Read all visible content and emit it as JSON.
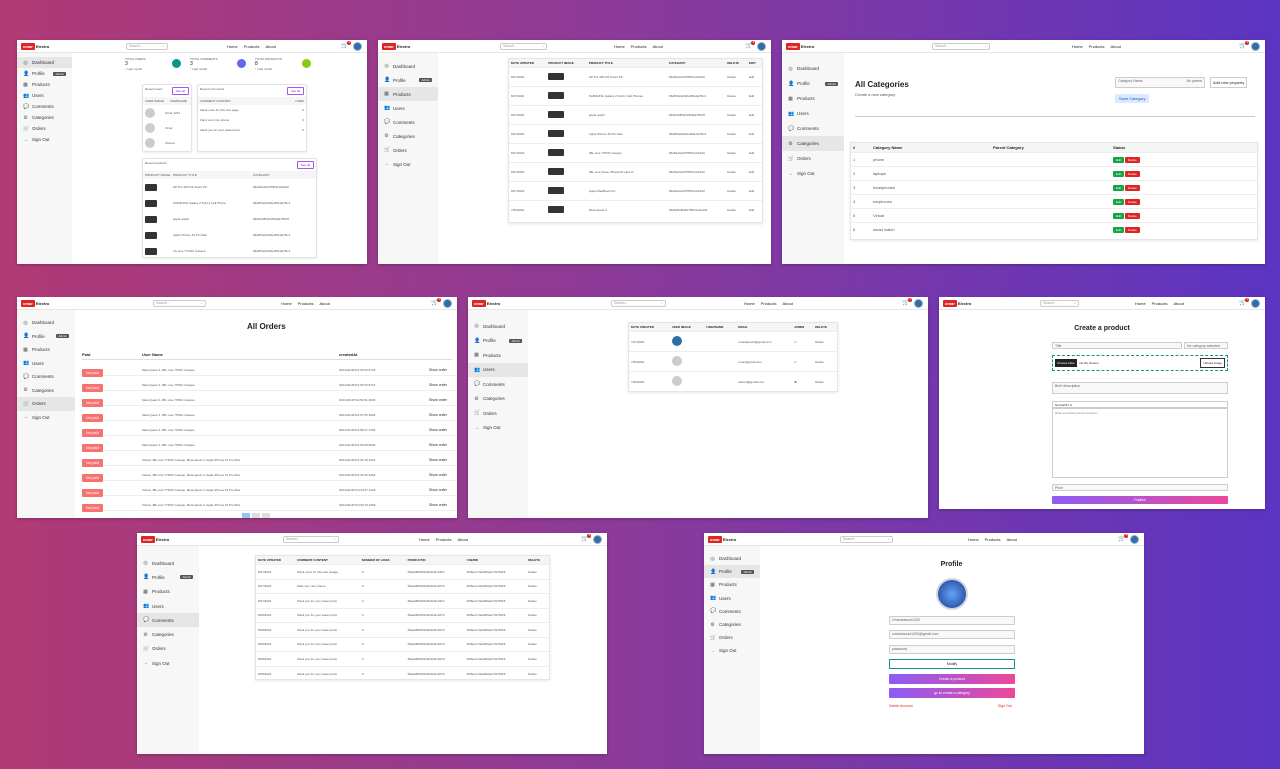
{
  "brand": {
    "first": "omar",
    "second": "Electro"
  },
  "nav": {
    "search": "Search...",
    "home": "Home",
    "products": "Products",
    "about": "About",
    "cart_count": "0"
  },
  "sidebar": {
    "dashboard": "Dashboard",
    "profile": "Profile",
    "admin_badge": "Admin",
    "products": "Products",
    "users": "Users",
    "comments": "Comments",
    "categories": "Categories",
    "orders": "Orders",
    "signout": "Sign Out"
  },
  "dashboard": {
    "stats": [
      {
        "label": "TOTAL USERS",
        "value": "3",
        "sub": "↑ Last month"
      },
      {
        "label": "TOTAL COMMENTS",
        "value": "3",
        "sub": "↑ Last month"
      },
      {
        "label": "TOTAL PRODUCTS",
        "value": "8",
        "sub": "↑ Last month"
      }
    ],
    "recent_users_title": "Recent users",
    "see_all": "See all",
    "user_cols": [
      "USER IMAGE",
      "USERNAME"
    ],
    "users": [
      "Omar 1231",
      "Omar",
      "Ahmed"
    ],
    "recent_comments_title": "Recent comments",
    "comment_cols": [
      "COMMENT CONTENT",
      "LIKES"
    ],
    "comments": [
      {
        "t": "thank omar for this nice page",
        "l": "0"
      },
      {
        "t": "that's very nice phone",
        "l": "0"
      },
      {
        "t": "thank you for your sweet price",
        "l": "0"
      }
    ],
    "recent_products_title": "Recent products",
    "product_cols": [
      "PRODUCT IMAGE",
      "PRODUCT TITLE",
      "CATEGORY"
    ],
    "products": [
      {
        "t": "HP Pro 400 G9 Tower PC",
        "c": "66a52a4c6d7f5637e6a440"
      },
      {
        "t": "SAMSUNG Galaxy Z Fold 4 Cell Phone",
        "c": "66a5b52a2f42e2f91da7fbc1"
      },
      {
        "t": "apple watch",
        "c": "66a5cf28f32c2f6da47530f7"
      },
      {
        "t": "Apple iPhone 15 Pro Max",
        "c": "66a5b52a2f42e2f91da7fbc1"
      },
      {
        "t": "LG Line 77OHC Casque",
        "c": "66a5b52a2f42e2f91da7fbc1"
      }
    ]
  },
  "products_page": {
    "cols": [
      "DATE UPDATED",
      "PRODUCT IMAGE",
      "PRODUCT TITLE",
      "CATEGORY",
      "DELETE",
      "EDIT"
    ],
    "rows": [
      {
        "d": "8/27/2024",
        "t": "HP Pro 400 G9 Tower PC",
        "c": "66a52a4c6d7f5637e6a440"
      },
      {
        "d": "8/27/2024",
        "t": "SAMSUNG Galaxy Z Fold 4 Cell Phones",
        "c": "66a5b52a2f42e2f91da7fbc1"
      },
      {
        "d": "8/27/2024",
        "t": "apple watch",
        "c": "66a5cf28f32c2f6da47530f7"
      },
      {
        "d": "8/27/2024",
        "t": "Apple iPhone 15 Pro Max",
        "c": "66a5b52a2f42e2f91da7fbc1"
      },
      {
        "d": "8/27/2024",
        "t": "JBL Line 770NC Casque",
        "c": "66a52a4c6d7f5637e6a440"
      },
      {
        "d": "8/27/2024",
        "t": "JBL Line Noise, Bluetooth sans fil",
        "c": "66a52a4c6d7f5637e6a440"
      },
      {
        "d": "8/27/2024",
        "t": "Apple MacBook Pro",
        "c": "66a52a4c6d7f5637e6a440"
      },
      {
        "d": "7/30/2024",
        "t": "Meta Quest 3",
        "c": "66a52f6d5d6d7f5637e6a440"
      }
    ],
    "delete": "Delete",
    "edit": "Edit"
  },
  "categories_page": {
    "title": "All Categories",
    "subtitle": "Create a new category",
    "name_ph": "Category Name",
    "parent_ph": "No parent",
    "add_prop": "Add new property",
    "save": "Save Category",
    "cols": [
      "#",
      "Category Name",
      "Parent Category",
      "Status"
    ],
    "rows": [
      {
        "n": "1",
        "c": "phone"
      },
      {
        "n": "2",
        "c": "laptops"
      },
      {
        "n": "3",
        "c": "headphones"
      },
      {
        "n": "4",
        "c": "earphones"
      },
      {
        "n": "5",
        "c": "Virtual"
      },
      {
        "n": "6",
        "c": "smart watch"
      }
    ],
    "edit": "Edit",
    "delete": "Delete"
  },
  "orders_page": {
    "title": "All Orders",
    "cols": [
      "Paid",
      "User Name",
      "createdAt"
    ],
    "not_paid": "Not paid",
    "show": "Show order",
    "rows": [
      {
        "u": "Meta Quest 3, JBL Line 770NC Casque",
        "d": "2024-08-30T11:52:53.072Z"
      },
      {
        "u": "Meta Quest 3, JBL Line 770NC Casque",
        "d": "2024-08-30T11:52:53.647Z"
      },
      {
        "u": "Meta Quest 3, JBL Line 770NC Casque",
        "d": "2024-08-30T11:54:51.400Z"
      },
      {
        "u": "Meta Quest 3, JBL Line 770NC Casque",
        "d": "2024-08-30T11:57:05.460Z"
      },
      {
        "u": "Meta Quest 3, JBL Line 770NC Casque",
        "d": "2024-08-30T11:58:47.770Z"
      },
      {
        "u": "Meta Quest 3, JBL Line 770NC Casque",
        "d": "2024-08-30T11:59:28.560Z"
      },
      {
        "u": "Virtual, JBL Line 770NC Casque, Meta Quest 3, Apple iPhone 15 Pro Max",
        "d": "2024-08-30T11:34:18.161Z"
      },
      {
        "u": "Virtual, JBL Line 770NC Casque, Meta Quest 3, Apple iPhone 15 Pro Max",
        "d": "2024-08-30T11:40:16.140Z"
      },
      {
        "u": "Virtual, JBL Line 770NC Casque, Meta Quest 3, Apple iPhone 15 Pro Max",
        "d": "2024-08-30T14:44:27.142Z"
      },
      {
        "u": "Virtual, JBL Line 770NC Casque, Meta Quest 3, Apple iPhone 15 Pro Max",
        "d": "2024-08-30T14:50:13.169Z"
      }
    ]
  },
  "users_page": {
    "cols": [
      "DATE CREATED",
      "USER IMAGE",
      "USERNAME",
      "EMAIL",
      "ADMIN",
      "DELETE"
    ],
    "rows": [
      {
        "d": "7/27/2024",
        "e": "omarlaaouni@gmail.com",
        "a": "✔"
      },
      {
        "d": "7/30/2024",
        "e": "omar@gmail.com",
        "a": "✔"
      },
      {
        "d": "7/30/2024",
        "e": "ahmed@gmail.com",
        "a": "✖"
      }
    ],
    "delete": "Delete"
  },
  "create_page": {
    "title": "Create a product",
    "title_ph": "Title",
    "cat_ph": "No category selected",
    "choose": "Choose Files",
    "nofile": "No file chosen",
    "upload": "Upload image",
    "brief_ph": "Brief description",
    "normal": "Normal",
    "editor_ph": "Write something about invitation",
    "price_ph": "Price",
    "publish": "Publish"
  },
  "comments_page": {
    "cols": [
      "DATE UPDATED",
      "COMMENT CONTENT",
      "NUMBER OF LIKES",
      "PRODUCTID",
      "USERID",
      "DELETE"
    ],
    "rows": [
      {
        "d": "8/27/2024",
        "t": "thank omar for this nice pieage",
        "p": "66aa28b9f22c9b0d11c3347",
        "u": "66f6ecc7a2a606ed7c9752b6"
      },
      {
        "d": "8/27/2024",
        "t": "thats very nice phone",
        "p": "66aa28b9f22c9b0d11c207b",
        "u": "66f6ecc7a2a606ed7c9752b6"
      },
      {
        "d": "8/27/2024",
        "t": "thank you for your sweet price",
        "p": "66aa28b9f22c9b0d11c3347",
        "u": "66f6ecc7a2a606ed7c9752b6"
      },
      {
        "d": "8/28/2024",
        "t": "thank you for your sweet price",
        "p": "66aa28b9f22c9b0d11c207b",
        "u": "66f6ecc7a2a606ed7c9752b6"
      },
      {
        "d": "8/28/2024",
        "t": "thank you for your sweet price",
        "p": "66aa28b9f22c9b0d11c207b",
        "u": "66f6ecc7a2a606ed7c9752b6"
      },
      {
        "d": "8/28/2024",
        "t": "thank you for your sweet price",
        "p": "66aa28b9f22c9b0d11c207b",
        "u": "66f6ecc7a2a606ed7c9752b6"
      },
      {
        "d": "8/28/2024",
        "t": "thank you for your sweet price",
        "p": "66aa28b9f22c9b0d11c207b",
        "u": "66f6ecc7a2a606ed7c9752b6"
      },
      {
        "d": "8/28/2024",
        "t": "thank you for your sweet price",
        "p": "66aa28b9f22c9b0d11c207b",
        "u": "66f6ecc7a2a606ed7c9752b6"
      }
    ],
    "likes": "0",
    "delete": "Delete"
  },
  "profile_page": {
    "title": "Profile",
    "username": "Omarlaaouni1200",
    "email": "omarlaaouni1200@gmail.com",
    "password_ph": "password",
    "update": "Modify",
    "create": "Create a product",
    "create2": "go to create a category",
    "delete_account": "Delete Account",
    "signout": "Sign Out"
  }
}
